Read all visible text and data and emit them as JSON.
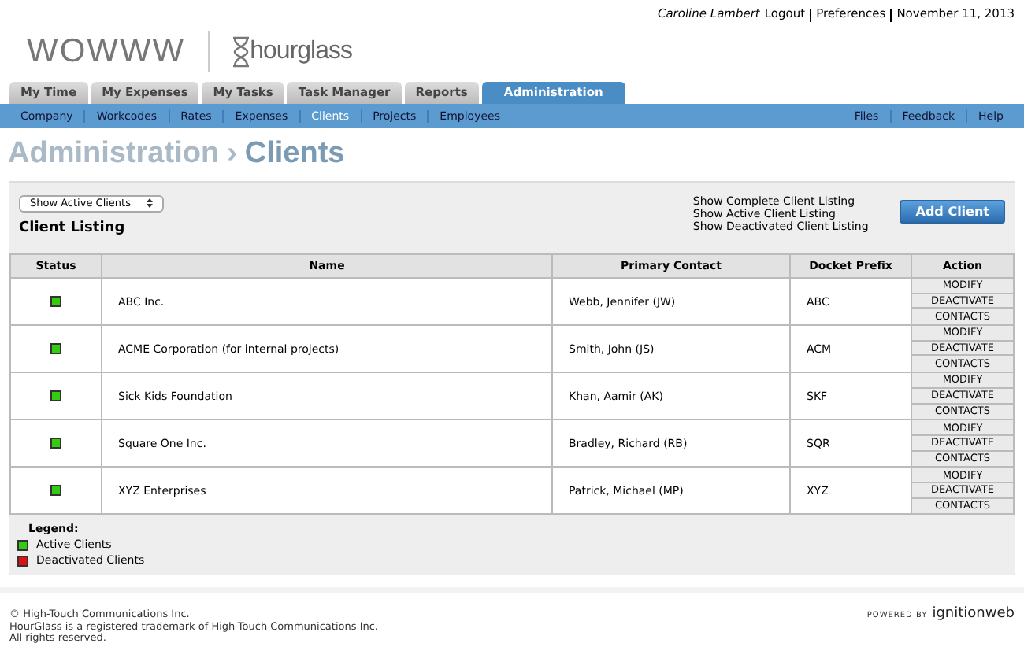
{
  "user_bar": {
    "user": "Caroline Lambert",
    "links": [
      "Logout",
      "Preferences"
    ],
    "date": "November 11, 2013"
  },
  "logo": {
    "brand": "WOWWW",
    "product": "hourglass"
  },
  "tabs": [
    {
      "label": "My Time",
      "selected": false
    },
    {
      "label": "My Expenses",
      "selected": false
    },
    {
      "label": "My Tasks",
      "selected": false
    },
    {
      "label": "Task Manager",
      "selected": false
    },
    {
      "label": "Reports",
      "selected": false
    },
    {
      "label": "Administration",
      "selected": true
    }
  ],
  "subnav": {
    "left": [
      {
        "label": "Company",
        "selected": false
      },
      {
        "label": "Workcodes",
        "selected": false
      },
      {
        "label": "Rates",
        "selected": false
      },
      {
        "label": "Expenses",
        "selected": false
      },
      {
        "label": "Clients",
        "selected": true
      },
      {
        "label": "Projects",
        "selected": false
      },
      {
        "label": "Employees",
        "selected": false
      }
    ],
    "right": [
      "Files",
      "Feedback",
      "Help"
    ]
  },
  "page_title": {
    "section": "Administration",
    "separator": "›",
    "page": "Clients"
  },
  "filter": {
    "value": "Show Active Clients"
  },
  "heading": "Client Listing",
  "listing_links": [
    "Show Complete Client Listing",
    "Show Active Client Listing",
    "Show Deactivated Client Listing"
  ],
  "add_button": "Add Client",
  "table": {
    "columns": [
      "Status",
      "Name",
      "Primary Contact",
      "Docket Prefix",
      "Action"
    ],
    "rows": [
      {
        "active": true,
        "name": "ABC Inc.",
        "contact": "Webb, Jennifer (JW)",
        "prefix": "ABC",
        "actions": [
          "MODIFY",
          "DEACTIVATE",
          "CONTACTS"
        ]
      },
      {
        "active": true,
        "name": "ACME Corporation (for internal projects)",
        "contact": "Smith, John (JS)",
        "prefix": "ACM",
        "actions": [
          "MODIFY",
          "DEACTIVATE",
          "CONTACTS"
        ]
      },
      {
        "active": true,
        "name": "Sick Kids Foundation",
        "contact": "Khan, Aamir (AK)",
        "prefix": "SKF",
        "actions": [
          "MODIFY",
          "DEACTIVATE",
          "CONTACTS"
        ]
      },
      {
        "active": true,
        "name": "Square One Inc.",
        "contact": "Bradley, Richard (RB)",
        "prefix": "SQR",
        "actions": [
          "MODIFY",
          "DEACTIVATE",
          "CONTACTS"
        ]
      },
      {
        "active": true,
        "name": "XYZ Enterprises",
        "contact": "Patrick, Michael (MP)",
        "prefix": "XYZ",
        "actions": [
          "MODIFY",
          "DEACTIVATE",
          "CONTACTS"
        ]
      }
    ]
  },
  "legend": {
    "title": "Legend:",
    "items": [
      {
        "label": "Active Clients",
        "color": "#33cc11"
      },
      {
        "label": "Deactivated Clients",
        "color": "#dd1111"
      }
    ]
  },
  "footer": {
    "lines": [
      "© High-Touch Communications Inc.",
      "HourGlass is a registered trademark of High-Touch Communications Inc.",
      "All rights reserved."
    ],
    "powered_by": "POWERED BY",
    "powered_brand": "ignitionweb"
  }
}
